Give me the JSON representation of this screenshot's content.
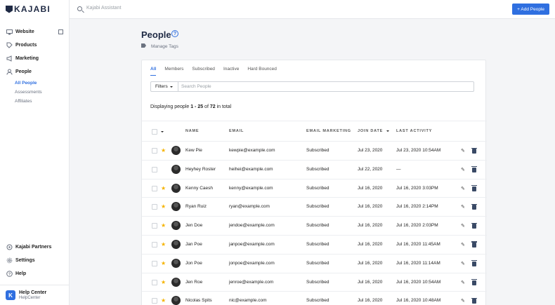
{
  "brand": {
    "name": "KAJABI"
  },
  "topbar": {
    "assistant_placeholder": "Kajabi Assistant",
    "add_button": "+ Add People"
  },
  "sidebar": {
    "items": [
      {
        "label": "Website",
        "icon": "monitor-icon"
      },
      {
        "label": "Products",
        "icon": "tag-icon"
      },
      {
        "label": "Marketing",
        "icon": "megaphone-icon"
      },
      {
        "label": "People",
        "icon": "person-icon"
      }
    ],
    "people_sub": [
      {
        "label": "All People",
        "active": true
      },
      {
        "label": "Assessments",
        "active": false
      },
      {
        "label": "Affiliates",
        "active": false
      }
    ],
    "bottom": [
      {
        "label": "Kajabi Partners",
        "icon": "partners-icon"
      },
      {
        "label": "Settings",
        "icon": "gear-icon"
      },
      {
        "label": "Help",
        "icon": "help-icon"
      }
    ],
    "help_center": {
      "title": "Help Center",
      "subtitle": "HelpCenter",
      "avatar": "K"
    }
  },
  "page": {
    "title": "People",
    "help_icon": "?",
    "manage_tags": "Manage Tags",
    "tabs": [
      "All",
      "Members",
      "Subscribed",
      "Inactive",
      "Hard Bounced"
    ],
    "active_tab": "All",
    "filters_label": "Filters",
    "search_placeholder": "Search People",
    "displaying": {
      "prefix": "Displaying people ",
      "range": "1 - 25",
      "mid": " of ",
      "total": "72",
      "suffix": " in total"
    }
  },
  "table": {
    "headers": {
      "name": "NAME",
      "email": "EMAIL",
      "marketing": "EMAIL MARKETING",
      "join_date": "JOIN DATE",
      "last_activity": "LAST ACTIVITY"
    },
    "rows": [
      {
        "starred": true,
        "name": "Kew Pie",
        "email": "kewpie@example.com",
        "marketing": "Subscribed",
        "join_date": "Jul 23, 2020",
        "last_activity": "Jul 23, 2020 10:54AM"
      },
      {
        "starred": false,
        "name": "Heyhey Roster",
        "email": "heihei@example.com",
        "marketing": "Subscribed",
        "join_date": "Jul 22, 2020",
        "last_activity": "—"
      },
      {
        "starred": true,
        "name": "Kenny Caesh",
        "email": "kenny@example.com",
        "marketing": "Subscribed",
        "join_date": "Jul 16, 2020",
        "last_activity": "Jul 16, 2020 3:03PM"
      },
      {
        "starred": true,
        "name": "Ryan Ruiz",
        "email": "ryan@example.com",
        "marketing": "Subscribed",
        "join_date": "Jul 16, 2020",
        "last_activity": "Jul 16, 2020 2:14PM"
      },
      {
        "starred": true,
        "name": "Jen Doe",
        "email": "jendoe@example.com",
        "marketing": "Subscribed",
        "join_date": "Jul 16, 2020",
        "last_activity": "Jul 16, 2020 2:03PM"
      },
      {
        "starred": true,
        "name": "Jan Poe",
        "email": "janpoe@example.com",
        "marketing": "Subscribed",
        "join_date": "Jul 16, 2020",
        "last_activity": "Jul 16, 2020 11:45AM"
      },
      {
        "starred": true,
        "name": "Jon Poe",
        "email": "jonpoe@example.com",
        "marketing": "Subscribed",
        "join_date": "Jul 16, 2020",
        "last_activity": "Jul 16, 2020 11:14AM"
      },
      {
        "starred": true,
        "name": "Jen Roe",
        "email": "jenroe@example.com",
        "marketing": "Subscribed",
        "join_date": "Jul 16, 2020",
        "last_activity": "Jul 16, 2020 10:54AM"
      },
      {
        "starred": true,
        "name": "Nicolas Spits",
        "email": "nic@example.com",
        "marketing": "Subscribed",
        "join_date": "Jul 16, 2020",
        "last_activity": "Jul 16, 2020 10:48AM"
      }
    ]
  },
  "colors": {
    "accent": "#2f6fe0",
    "star": "#f5b300",
    "navy": "#1f2a44"
  }
}
